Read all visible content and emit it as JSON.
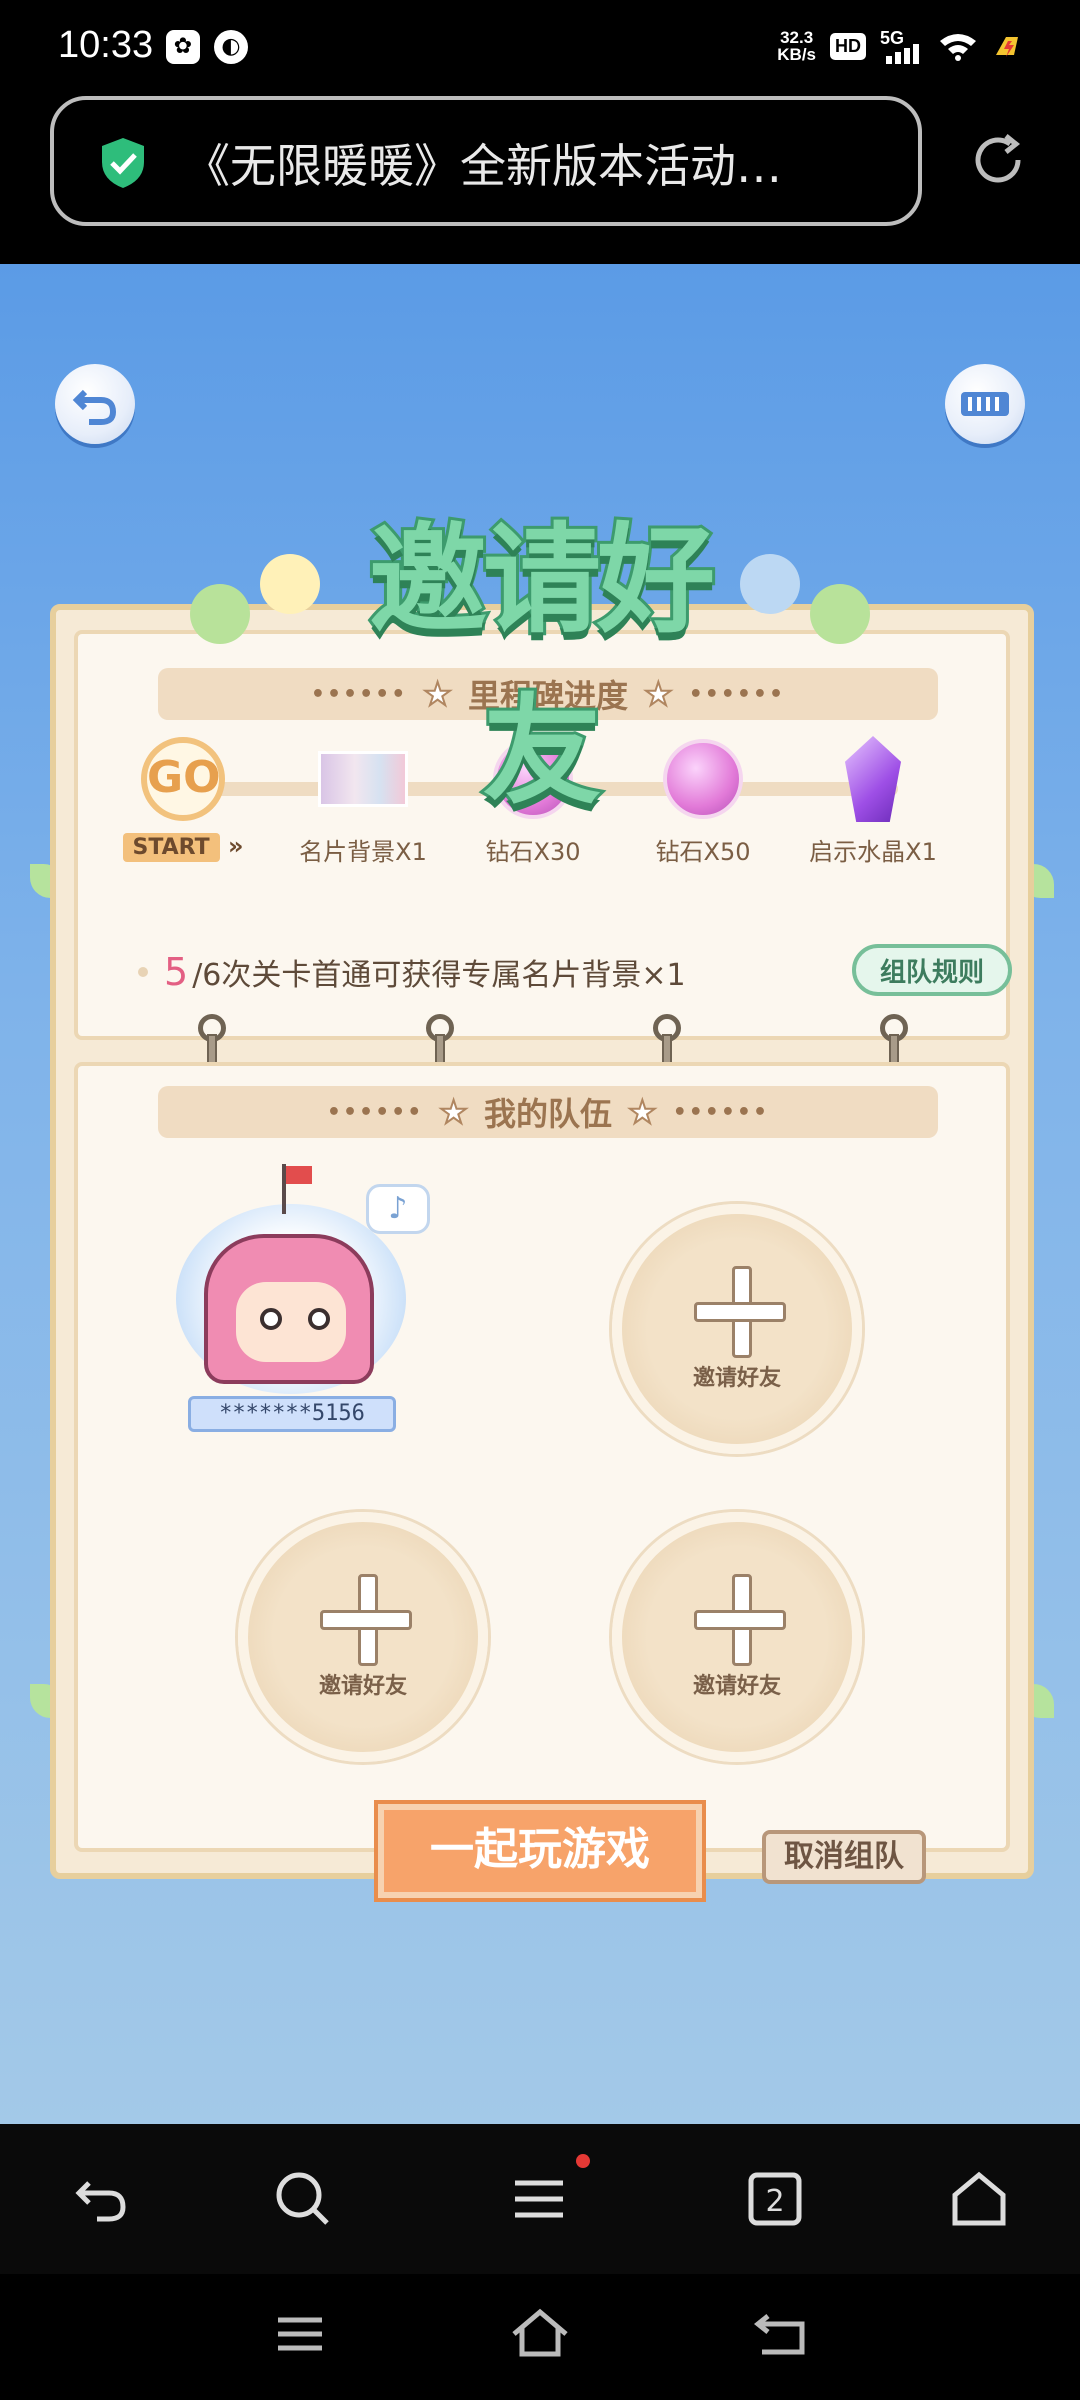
{
  "status_bar": {
    "time": "10:33",
    "net_speed_value": "32.3",
    "net_speed_unit": "KB/s",
    "hd_label": "HD",
    "network_label": "5G"
  },
  "browser": {
    "url_title": "《无限暖暖》全新版本活动…",
    "tab_count": "2"
  },
  "game": {
    "title": "邀请好友",
    "milestone_header": "里程碑进度",
    "milestones": [
      {
        "label": "START",
        "icon": "go-icon",
        "go_text": "GO"
      },
      {
        "label": "名片背景X1",
        "icon": "card-background-icon"
      },
      {
        "label": "钻石X30",
        "icon": "diamond-icon"
      },
      {
        "label": "钻石X50",
        "icon": "diamond-icon"
      },
      {
        "label": "启示水晶X1",
        "icon": "crystal-icon"
      }
    ],
    "progress_current": "5",
    "progress_text": "/6次关卡首通可获得专属名片背景×1",
    "rules_button": "组队规则",
    "team_header": "我的队伍",
    "member_name": "*******5156",
    "invite_label": "邀请好友",
    "play_button": "一起玩游戏",
    "cancel_button": "取消组队",
    "colors": {
      "title_green": "#7ed7a8",
      "play_orange": "#f7a36a",
      "progress_pink": "#e35f83"
    }
  }
}
